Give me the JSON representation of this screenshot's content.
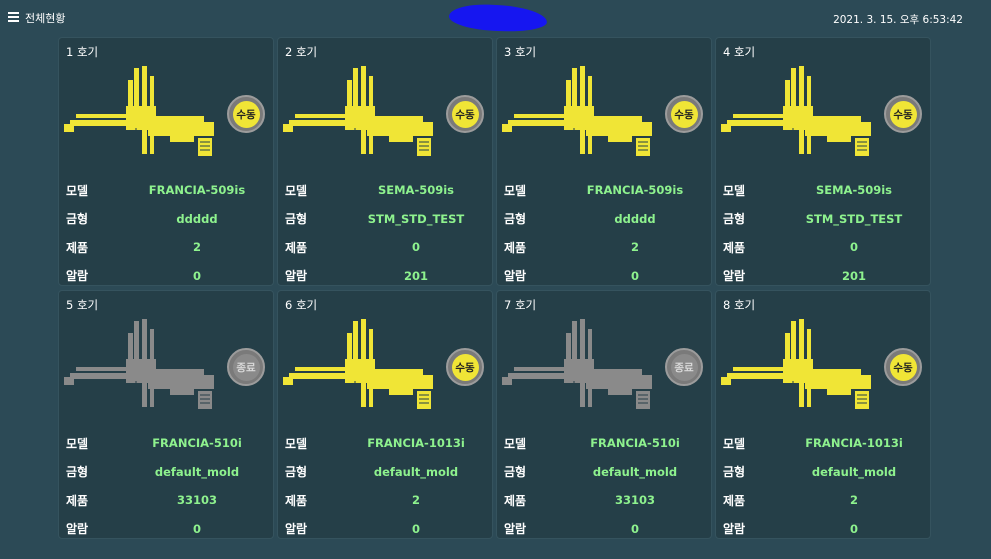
{
  "header": {
    "title": "전체현황",
    "datetime": "2021. 3. 15. 오후 6:53:42"
  },
  "colors": {
    "background": "#2c4a56",
    "card": "#253f48",
    "robot_active": "#f0e536",
    "robot_inactive": "#8a8a8a",
    "value_green": "#8ef28e"
  },
  "labels": {
    "model": "모델",
    "mold": "금형",
    "product": "제품",
    "alarm": "알람"
  },
  "machines": [
    {
      "name": "1 호기",
      "status": "수동",
      "state": "manual",
      "model": "FRANCIA-509is",
      "mold": "ddddd",
      "product": "2",
      "alarm": "0"
    },
    {
      "name": "2 호기",
      "status": "수동",
      "state": "manual",
      "model": "SEMA-509is",
      "mold": "STM_STD_TEST",
      "product": "0",
      "alarm": "201"
    },
    {
      "name": "3 호기",
      "status": "수동",
      "state": "manual",
      "model": "FRANCIA-509is",
      "mold": "ddddd",
      "product": "2",
      "alarm": "0"
    },
    {
      "name": "4 호기",
      "status": "수동",
      "state": "manual",
      "model": "SEMA-509is",
      "mold": "STM_STD_TEST",
      "product": "0",
      "alarm": "201"
    },
    {
      "name": "5 호기",
      "status": "종료",
      "state": "stopped",
      "model": "FRANCIA-510i",
      "mold": "default_mold",
      "product": "33103",
      "alarm": "0"
    },
    {
      "name": "6 호기",
      "status": "수동",
      "state": "manual",
      "model": "FRANCIA-1013i",
      "mold": "default_mold",
      "product": "2",
      "alarm": "0"
    },
    {
      "name": "7 호기",
      "status": "종료",
      "state": "stopped",
      "model": "FRANCIA-510i",
      "mold": "default_mold",
      "product": "33103",
      "alarm": "0"
    },
    {
      "name": "8 호기",
      "status": "수동",
      "state": "manual",
      "model": "FRANCIA-1013i",
      "mold": "default_mold",
      "product": "2",
      "alarm": "0"
    }
  ]
}
